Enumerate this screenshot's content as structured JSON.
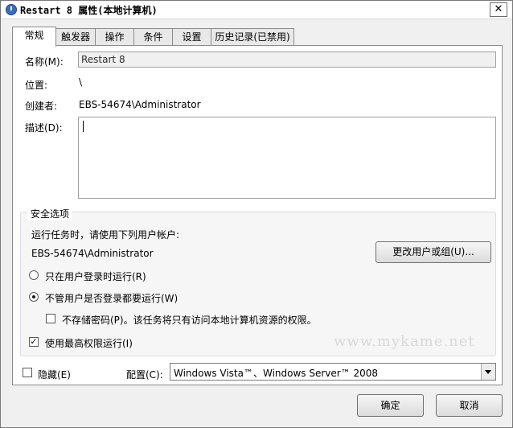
{
  "window": {
    "title": "Restart 8 属性(本地计算机)",
    "close_glyph": "✕"
  },
  "tabs": [
    {
      "label": "常规",
      "active": true
    },
    {
      "label": "触发器"
    },
    {
      "label": "操作"
    },
    {
      "label": "条件"
    },
    {
      "label": "设置"
    },
    {
      "label": "历史记录(已禁用)"
    }
  ],
  "general": {
    "name_label": "名称(M):",
    "name_value": "Restart 8",
    "location_label": "位置:",
    "location_value": "\\",
    "author_label": "创建者:",
    "author_value": "EBS-54674\\Administrator",
    "description_label": "描述(D):",
    "description_value": ""
  },
  "security": {
    "group_title": "安全选项",
    "run_as_prompt": "运行任务时，请使用下列用户帐户:",
    "user_account": "EBS-54674\\Administrator",
    "change_user_button": "更改用户或组(U)...",
    "option_logged_on_only": "只在用户登录时运行(R)",
    "option_whether_logged_on": "不管用户是否登录都要运行(W)",
    "selected_option": "whether_logged_on",
    "do_not_store_password": "不存储密码(P)。该任务将只有访问本地计算机资源的权限。",
    "do_not_store_password_checked": false,
    "highest_privileges": "使用最高权限运行(I)",
    "highest_privileges_checked": true,
    "check_glyph": "✓"
  },
  "bottom": {
    "hidden_label": "隐藏(E)",
    "hidden_checked": false,
    "configure_label": "配置(C):",
    "configure_value": "Windows Vista™、Windows Server™ 2008"
  },
  "buttons": {
    "ok": "确定",
    "cancel": "取消"
  },
  "watermark": "www.mykame.net"
}
